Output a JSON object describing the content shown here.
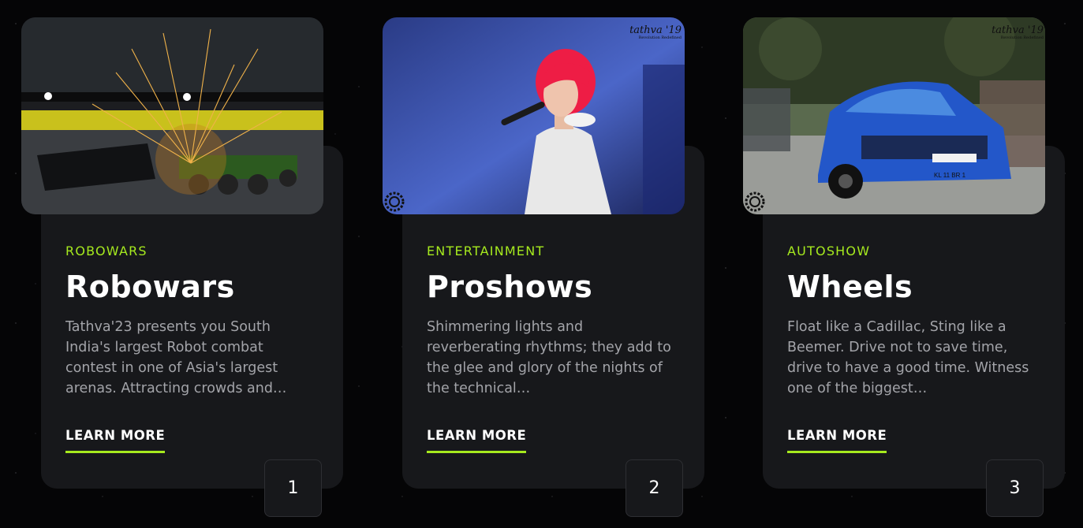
{
  "cards": [
    {
      "category": "ROBOWARS",
      "title": "Robowars",
      "description": "Tathva'23 presents you South India's largest Robot combat contest in one of Asia's largest arenas. Attracting crowds and…",
      "cta": "LEARN MORE",
      "number": "1",
      "image_subject": "robot-combat-sparks"
    },
    {
      "category": "ENTERTAINMENT",
      "title": "Proshows",
      "description": "Shimmering lights and reverberating rhythms; they add to the glee and glory of the nights of the technical…",
      "cta": "LEARN MORE",
      "number": "2",
      "image_subject": "singer-on-stage",
      "watermark": "tathva '19",
      "watermark_sub": "Revolution Redefined"
    },
    {
      "category": "AUTOSHOW",
      "title": "Wheels",
      "description": "Float like a Cadillac, Sting like a Beemer. Drive not to save time, drive to have a good time. Witness one of the biggest…",
      "cta": "LEARN MORE",
      "number": "3",
      "image_subject": "blue-suv-crowd",
      "watermark": "tathva '19",
      "watermark_sub": "Revolution Redefined",
      "plate": "KL 11 BR 1"
    }
  ],
  "colors": {
    "accent": "#a6ea1e",
    "card_bg": "#17181b",
    "page_bg": "#050506",
    "text_muted": "#a3a4a9"
  }
}
